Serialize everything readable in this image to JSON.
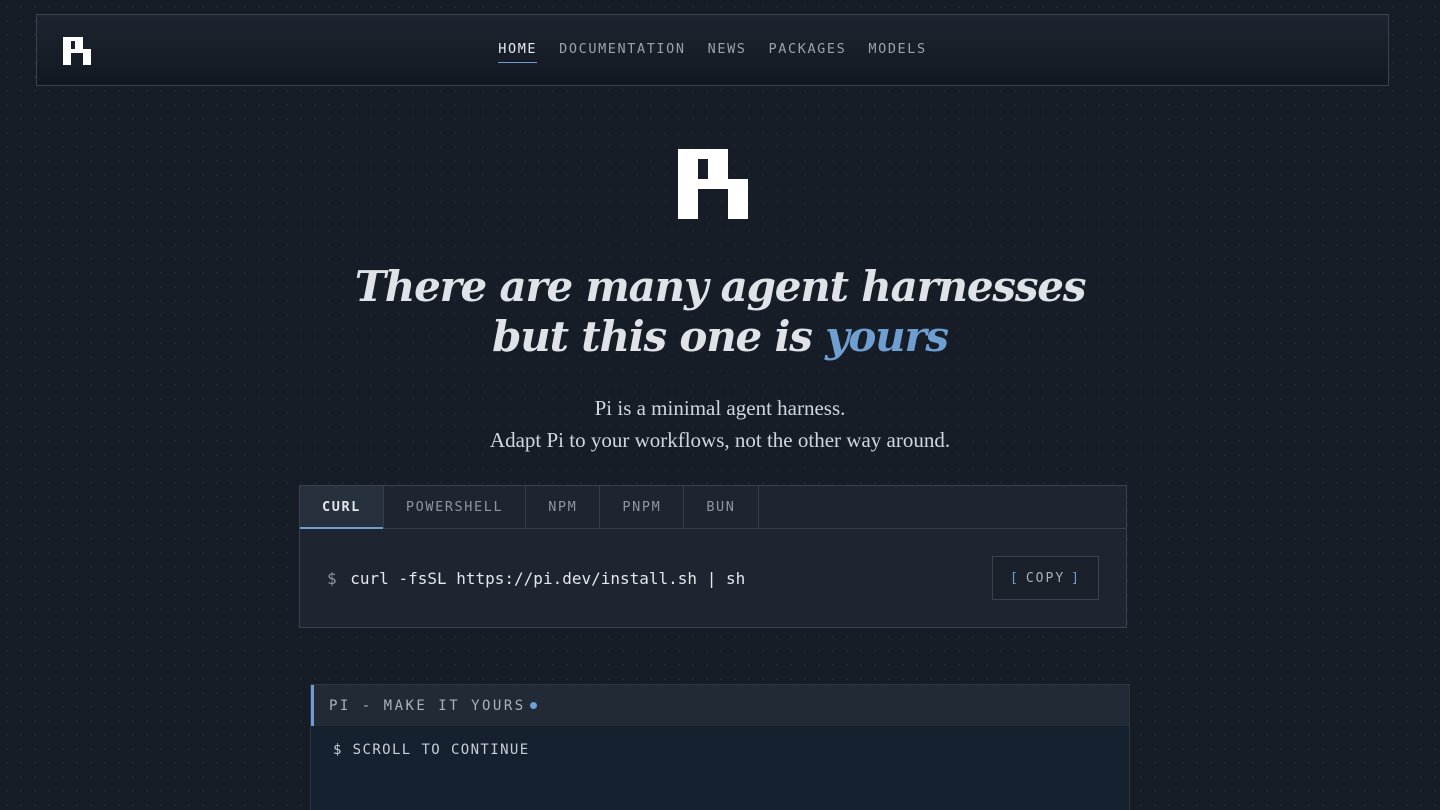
{
  "nav": {
    "logo": "pi-logo",
    "links": [
      {
        "label": "HOME",
        "active": true
      },
      {
        "label": "DOCUMENTATION",
        "active": false
      },
      {
        "label": "NEWS",
        "active": false
      },
      {
        "label": "PACKAGES",
        "active": false
      },
      {
        "label": "MODELS",
        "active": false
      }
    ]
  },
  "hero": {
    "logo": "pi-logo",
    "headline_line1": "There are many agent harnesses",
    "headline_line2_prefix": "but this one is ",
    "headline_line2_accent": "yours",
    "subtitle_line1": "Pi is a minimal agent harness.",
    "subtitle_line2": "Adapt Pi to your workflows, not the other way around."
  },
  "install": {
    "tabs": [
      {
        "label": "CURL",
        "active": true
      },
      {
        "label": "POWERSHELL",
        "active": false
      },
      {
        "label": "NPM",
        "active": false
      },
      {
        "label": "PNPM",
        "active": false
      },
      {
        "label": "BUN",
        "active": false
      }
    ],
    "prompt": "$",
    "command": "curl -fsSL https://pi.dev/install.sh | sh",
    "copy_label": "COPY",
    "copy_bracket_open": "[",
    "copy_bracket_close": "]"
  },
  "terminal": {
    "title": "PI - MAKE IT YOURS",
    "line": "$ SCROLL TO CONTINUE"
  },
  "colors": {
    "background": "#161d27",
    "accent": "#6f9ed1",
    "text": "#e6e8ec"
  }
}
